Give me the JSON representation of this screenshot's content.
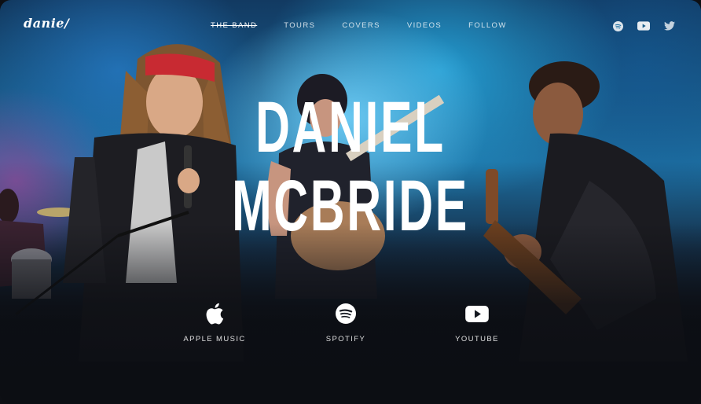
{
  "logo": "danie/",
  "nav": {
    "items": [
      {
        "label": "THE BAND",
        "active": true
      },
      {
        "label": "TOURS",
        "active": false
      },
      {
        "label": "COVERS",
        "active": false
      },
      {
        "label": "VIDEOS",
        "active": false
      },
      {
        "label": "FOLLOW",
        "active": false
      }
    ]
  },
  "social": [
    "spotify-icon",
    "youtube-icon",
    "twitter-icon"
  ],
  "hero": {
    "title_line1": "DANIEL",
    "title_line2": "MCBRIDE"
  },
  "streaming": [
    {
      "label": "APPLE MUSIC",
      "icon": "apple-icon"
    },
    {
      "label": "SPOTIFY",
      "icon": "spotify-icon"
    },
    {
      "label": "YOUTUBE",
      "icon": "youtube-icon"
    }
  ],
  "colors": {
    "text": "#ffffff",
    "smoke_blue": "#2cb0e6",
    "smoke_purple": "#9a4a98",
    "background_dark": "#0c0e13"
  }
}
